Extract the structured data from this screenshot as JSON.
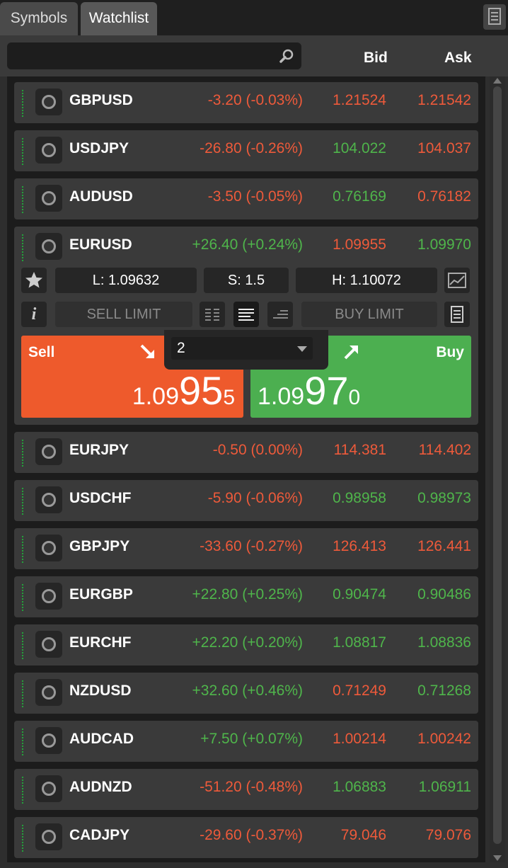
{
  "tabs": [
    "Symbols",
    "Watchlist"
  ],
  "columns": {
    "bid": "Bid",
    "ask": "Ask"
  },
  "search": {
    "placeholder": ""
  },
  "rows": [
    {
      "symbol": "GBPUSD",
      "change": "-3.20 (-0.03%)",
      "change_dir": "down",
      "bid": "1.21524",
      "bid_dir": "down",
      "ask": "1.21542",
      "ask_dir": "down"
    },
    {
      "symbol": "USDJPY",
      "change": "-26.80 (-0.26%)",
      "change_dir": "down",
      "bid": "104.022",
      "bid_dir": "up",
      "ask": "104.037",
      "ask_dir": "down"
    },
    {
      "symbol": "AUDUSD",
      "change": "-3.50 (-0.05%)",
      "change_dir": "down",
      "bid": "0.76169",
      "bid_dir": "up",
      "ask": "0.76182",
      "ask_dir": "down"
    },
    {
      "symbol": "EURUSD",
      "change": "+26.40 (+0.24%)",
      "change_dir": "up",
      "bid": "1.09955",
      "bid_dir": "down",
      "ask": "1.09970",
      "ask_dir": "up"
    },
    {
      "symbol": "EURJPY",
      "change": "-0.50 (0.00%)",
      "change_dir": "down",
      "bid": "114.381",
      "bid_dir": "down",
      "ask": "114.402",
      "ask_dir": "down"
    },
    {
      "symbol": "USDCHF",
      "change": "-5.90 (-0.06%)",
      "change_dir": "down",
      "bid": "0.98958",
      "bid_dir": "up",
      "ask": "0.98973",
      "ask_dir": "up"
    },
    {
      "symbol": "GBPJPY",
      "change": "-33.60 (-0.27%)",
      "change_dir": "down",
      "bid": "126.413",
      "bid_dir": "down",
      "ask": "126.441",
      "ask_dir": "down"
    },
    {
      "symbol": "EURGBP",
      "change": "+22.80 (+0.25%)",
      "change_dir": "up",
      "bid": "0.90474",
      "bid_dir": "up",
      "ask": "0.90486",
      "ask_dir": "up"
    },
    {
      "symbol": "EURCHF",
      "change": "+22.20 (+0.20%)",
      "change_dir": "up",
      "bid": "1.08817",
      "bid_dir": "up",
      "ask": "1.08836",
      "ask_dir": "up"
    },
    {
      "symbol": "NZDUSD",
      "change": "+32.60 (+0.46%)",
      "change_dir": "up",
      "bid": "0.71249",
      "bid_dir": "down",
      "ask": "0.71268",
      "ask_dir": "up"
    },
    {
      "symbol": "AUDCAD",
      "change": "+7.50 (+0.07%)",
      "change_dir": "up",
      "bid": "1.00214",
      "bid_dir": "down",
      "ask": "1.00242",
      "ask_dir": "down"
    },
    {
      "symbol": "AUDNZD",
      "change": "-51.20 (-0.48%)",
      "change_dir": "down",
      "bid": "1.06883",
      "bid_dir": "up",
      "ask": "1.06911",
      "ask_dir": "up"
    },
    {
      "symbol": "CADJPY",
      "change": "-29.60 (-0.37%)",
      "change_dir": "down",
      "bid": "79.046",
      "bid_dir": "down",
      "ask": "79.076",
      "ask_dir": "down"
    }
  ],
  "expanded": {
    "low": "L: 1.09632",
    "spread": "S: 1.5",
    "high": "H: 1.10072",
    "sell_limit": "SELL LIMIT",
    "buy_limit": "BUY LIMIT",
    "quantity": "2",
    "sell": {
      "label": "Sell",
      "price_a": "1.09",
      "price_b": "95",
      "price_c": "5"
    },
    "buy": {
      "label": "Buy",
      "price_a": "1.09",
      "price_b": "97",
      "price_c": "0"
    },
    "info_glyph": "i"
  },
  "colors": {
    "up": "#4fb54b",
    "down": "#ee5a3a",
    "sell": "#ee5a2c",
    "buy": "#4caf50"
  },
  "icons": [
    "search-icon",
    "tab-menu-icon",
    "star-icon",
    "chart-icon",
    "info-icon",
    "layout-list-icon",
    "layout-wide-icon",
    "layout-compact-icon",
    "ticket-icon",
    "sell-arrow-icon",
    "buy-arrow-icon"
  ]
}
